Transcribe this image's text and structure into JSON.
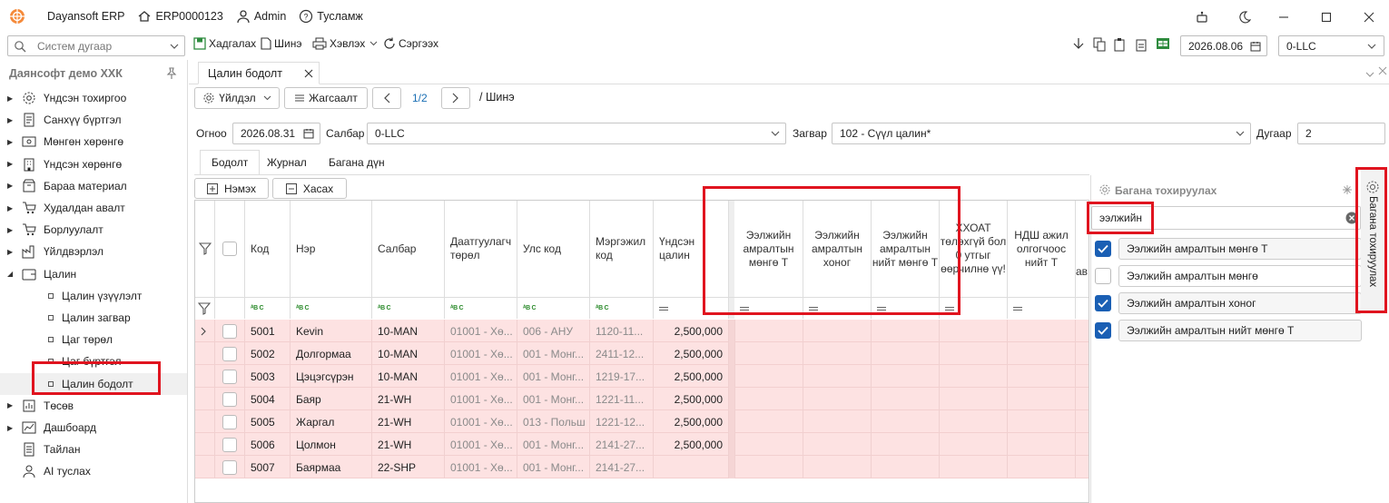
{
  "titlebar": {
    "app_name": "Dayansoft ERP",
    "doc_code": "ERP0000123",
    "user": "Admin",
    "help": "Тусламж"
  },
  "toolbar": {
    "system_number_placeholder": "Систем дугаар",
    "save": "Хадгалах",
    "new": "Шинэ",
    "print": "Хэвлэх",
    "refresh": "Сэргээх",
    "date": "2026.08.06",
    "company": "0-LLC"
  },
  "sidebar": {
    "company": "Даянсофт демо ХХК",
    "items": [
      {
        "label": "Үндсэн тохиргоо"
      },
      {
        "label": "Санхүү бүртгэл"
      },
      {
        "label": "Мөнгөн хөрөнгө"
      },
      {
        "label": "Үндсэн хөрөнгө"
      },
      {
        "label": "Бараа материал"
      },
      {
        "label": "Худалдан авалт"
      },
      {
        "label": "Борлуулалт"
      },
      {
        "label": "Үйлдвэрлэл"
      },
      {
        "label": "Цалин"
      },
      {
        "label": "Цалин үзүүлэлт"
      },
      {
        "label": "Цалин загвар"
      },
      {
        "label": "Цаг төрөл"
      },
      {
        "label": "Цаг бүртгэл"
      },
      {
        "label": "Цалин бодолт"
      },
      {
        "label": "Төсөв"
      },
      {
        "label": "Дашбоард"
      },
      {
        "label": "Тайлан"
      },
      {
        "label": "AI туслах"
      }
    ]
  },
  "document_tab": {
    "label": "Цалин бодолт"
  },
  "actions": {
    "process": "Үйлдэл",
    "list": "Жагсаалт",
    "pager": "1/2",
    "path": "/ Шинэ"
  },
  "form": {
    "date_label": "Огноо",
    "date_value": "2026.08.31",
    "branch_label": "Салбар",
    "branch_value": "0-LLC",
    "template_label": "Загвар",
    "template_value": "102 - Сүүл цалин*",
    "number_label": "Дугаар",
    "number_value": "2"
  },
  "inner_tabs": [
    "Бодолт",
    "Журнал",
    "Багана дүн"
  ],
  "grid_buttons": {
    "add": "Нэмэх",
    "remove": "Хасах"
  },
  "grid": {
    "headers": {
      "code": "Код",
      "name": "Нэр",
      "branch": "Салбар",
      "insurance": "Даатгуулагч төрөл",
      "country": "Улс код",
      "profession": "Мэргэжил код",
      "salary": "Үндсэн цалин",
      "vac_t": "Ээлжийн амралтын мөнгө Т",
      "vac_days": "Ээлжийн амралтын хоног",
      "vac_total": "Ээлжийн амралтын нийт мөнгө Т",
      "tax": "ХХОАТ төлөхгүй бол 0 утгыг өөрчилнө үү!",
      "ndsh": "НДШ ажил олгогчоос нийт Т",
      "more": "ав"
    },
    "rows": [
      {
        "code": "5001",
        "name": "Kevin",
        "branch": "10-MAN",
        "insurance": "01001 - Хө...",
        "country": "006 - АНУ",
        "profession": "1120-11...",
        "salary": "2,500,000"
      },
      {
        "code": "5002",
        "name": "Долгормаа",
        "branch": "10-MAN",
        "insurance": "01001 - Хө...",
        "country": "001 - Монг...",
        "profession": "2411-12...",
        "salary": "2,500,000"
      },
      {
        "code": "5003",
        "name": "Цэцэгсүрэн",
        "branch": "10-MAN",
        "insurance": "01001 - Хө...",
        "country": "001 - Монг...",
        "profession": "1219-17...",
        "salary": "2,500,000"
      },
      {
        "code": "5004",
        "name": "Баяр",
        "branch": "21-WH",
        "insurance": "01001 - Хө...",
        "country": "001 - Монг...",
        "profession": "1221-11...",
        "salary": "2,500,000"
      },
      {
        "code": "5005",
        "name": "Жаргал",
        "branch": "21-WH",
        "insurance": "01001 - Хө...",
        "country": "013 - Польш",
        "profession": "1221-12...",
        "salary": "2,500,000"
      },
      {
        "code": "5006",
        "name": "Цолмон",
        "branch": "21-WH",
        "insurance": "01001 - Хө...",
        "country": "001 - Монг...",
        "profession": "2141-27...",
        "salary": "2,500,000"
      },
      {
        "code": "5007",
        "name": "Баярмаа",
        "branch": "22-SHP",
        "insurance": "01001 - Хө...",
        "country": "001 - Монг...",
        "profession": "2141-27...",
        "salary": ""
      }
    ]
  },
  "column_panel": {
    "title": "Багана тохируулах",
    "search_value": "ээлжийн",
    "items": [
      {
        "label": "Ээлжийн амралтын мөнгө Т",
        "checked": true
      },
      {
        "label": "Ээлжийн амралтын мөнгө",
        "checked": false
      },
      {
        "label": "Ээлжийн амралтын хоног",
        "checked": true
      },
      {
        "label": "Ээлжийн амралтын нийт мөнгө Т",
        "checked": true
      }
    ]
  },
  "side_tab": {
    "label": "Багана тохируулах"
  },
  "colors": {
    "accent": "#1a5fb4",
    "highlight": "#e0141f",
    "row_pink": "#fde2e2"
  }
}
